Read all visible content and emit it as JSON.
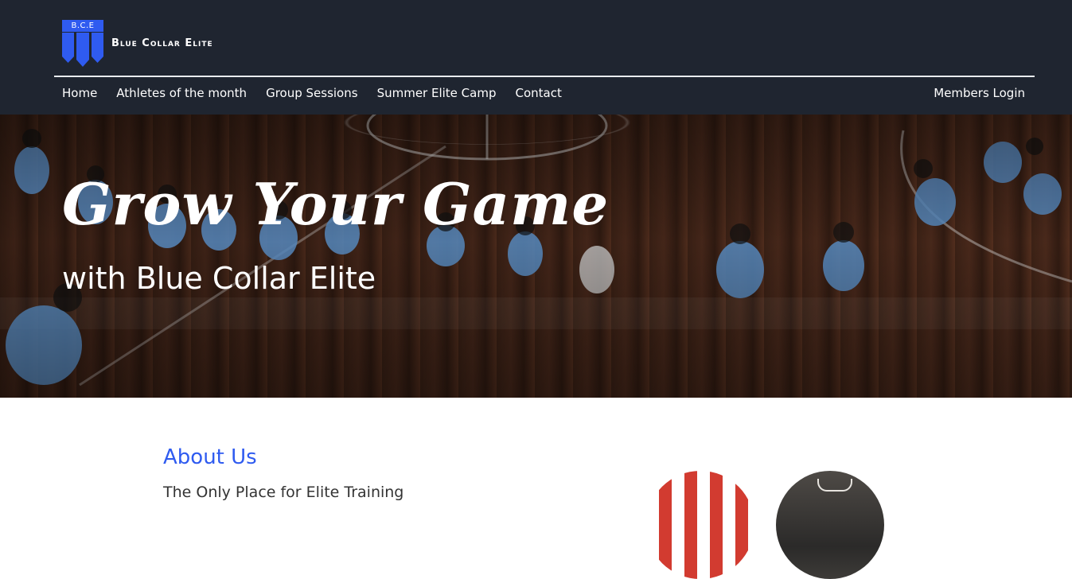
{
  "logo": {
    "badge_text": "B.C.E",
    "name": "Blue Collar Elite",
    "brand_color": "#2f5bf0"
  },
  "nav": {
    "items": [
      "Home",
      "Athletes of the month",
      "Group Sessions",
      "Summer Elite Camp",
      "Contact"
    ],
    "login": "Members Login"
  },
  "hero": {
    "title": "Grow Your Game",
    "subtitle": "with Blue Collar Elite"
  },
  "about": {
    "title": "About Us",
    "subtitle": "The Only Place for Elite Training"
  },
  "colors": {
    "header_bg": "#1f2530",
    "accent": "#2f5bf0",
    "text_dark": "#333333"
  }
}
